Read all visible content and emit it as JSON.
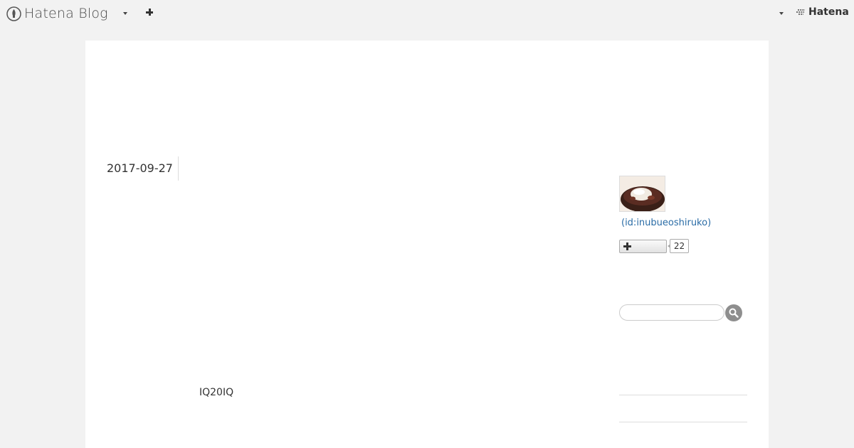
{
  "global_header": {
    "brand_text": "Hatena Blog",
    "hatena_text": "Hatena"
  },
  "entry": {
    "date": "2017-09-27",
    "text": "IQ20IQ"
  },
  "sidebar": {
    "profile": {
      "user_id": "(id:inubueoshiruko)",
      "subscriber_count": "22"
    },
    "search": {
      "placeholder": ""
    }
  },
  "colors": {
    "background": "#f2f2f2",
    "link": "#2a6ca6",
    "search_button": "#8e8e8e"
  }
}
